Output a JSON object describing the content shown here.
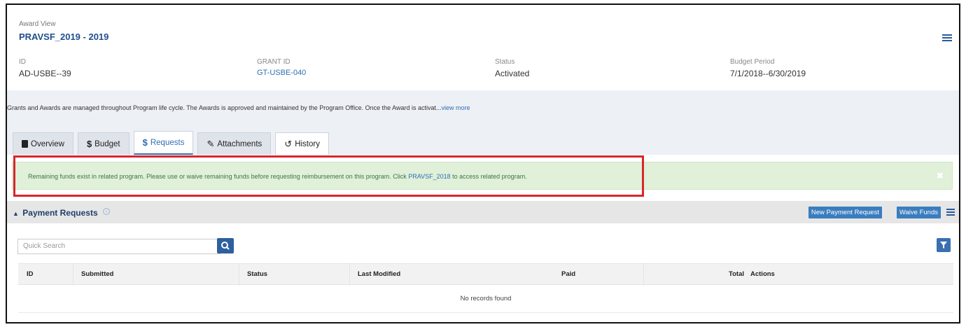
{
  "award": {
    "caption": "Award View",
    "title": "PRAVSF_2019 - 2019",
    "fields": [
      {
        "label": "ID",
        "value": "AD-USBE--39"
      },
      {
        "label": "GRANT ID",
        "value": "GT-USBE-040"
      },
      {
        "label": "Status",
        "value": "Activated"
      },
      {
        "label": "Budget Period",
        "value": "7/1/2018--6/30/2019"
      }
    ]
  },
  "description": {
    "text": "Grants and Awards are managed throughout Program life cycle. The Awards is approved and maintained by the Program Office. Once the Award is activat...",
    "more_link": "view more"
  },
  "tabs": [
    {
      "label": "Overview",
      "icon": "book-icon",
      "active": false
    },
    {
      "label": "Budget",
      "icon": "dollar-icon",
      "active": false
    },
    {
      "label": "Requests",
      "icon": "dollar-icon",
      "active": true
    },
    {
      "label": "Attachments",
      "icon": "paperclip-icon",
      "active": false
    },
    {
      "label": "History",
      "icon": "history-icon",
      "active": false
    }
  ],
  "alert": {
    "text_before": "Remaining funds exist in related program. Please use or waive remaining funds before requesting reimbursement on this program. Click ",
    "link": "PRAVSF_2018",
    "text_after": " to access related program.",
    "close_icon": "close-icon"
  },
  "payment_requests": {
    "title": "Payment Requests",
    "new_button": "New Payment Request",
    "waive_button": "Waive Funds",
    "search_placeholder": "Quick Search",
    "columns": [
      "ID",
      "Submitted",
      "Status",
      "Last Modified",
      "Paid",
      "Total",
      "Actions"
    ],
    "empty_message": "No records found"
  },
  "colors": {
    "accent": "#2e6fb3",
    "alert_bg": "#e0f0d9",
    "alert_text": "#3c763d",
    "highlight_border": "#d9262c"
  }
}
